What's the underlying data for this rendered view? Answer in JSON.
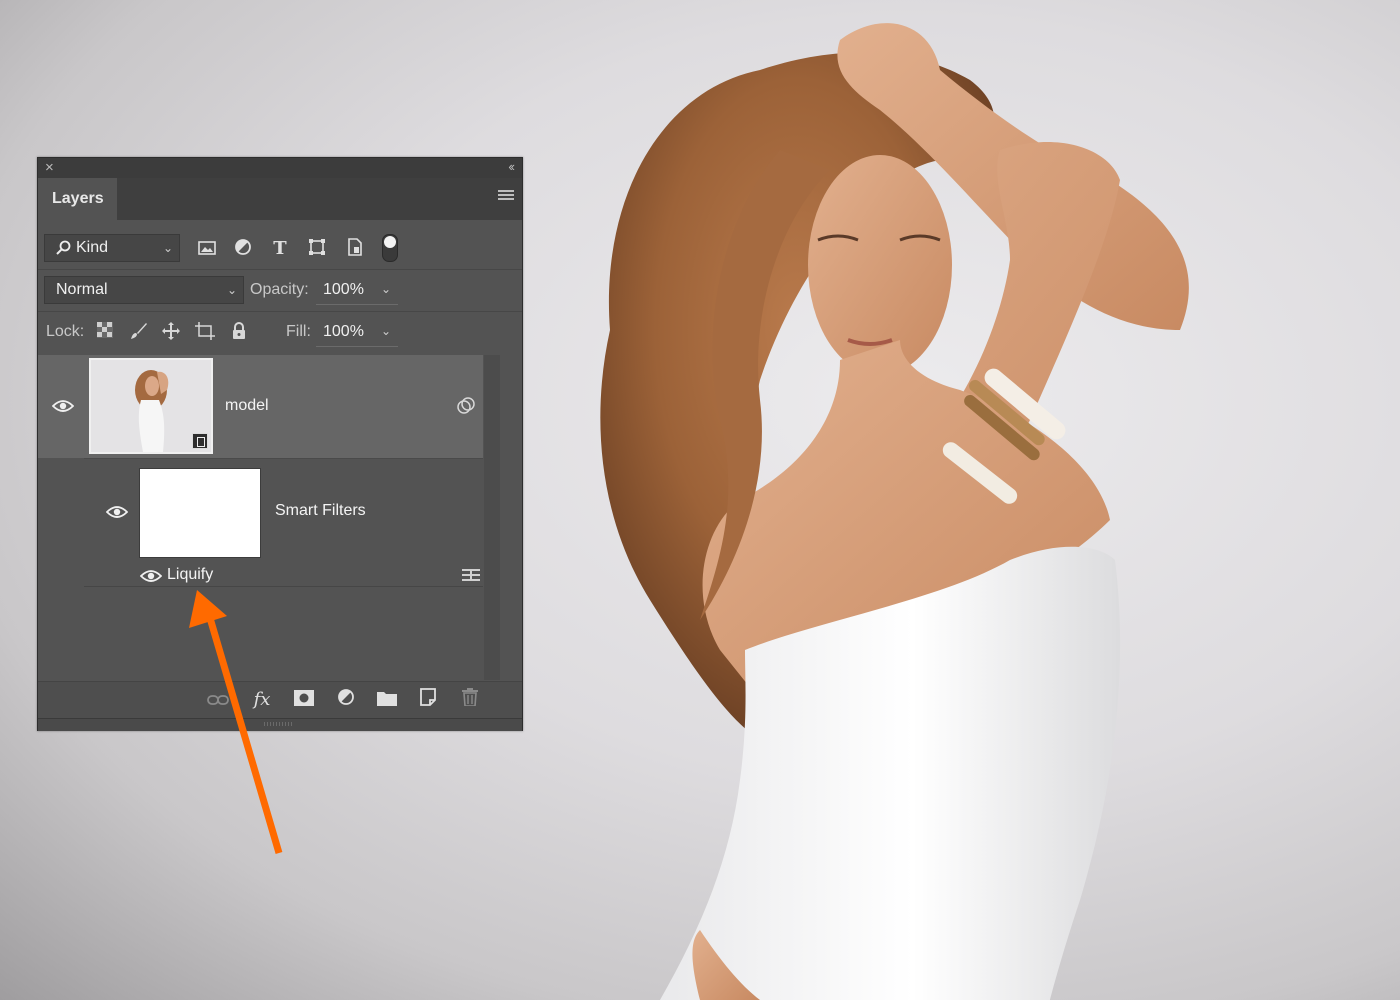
{
  "panel": {
    "tab_label": "Layers",
    "close_glyph": "×",
    "collapse_glyph": "‹‹"
  },
  "filter": {
    "kind_label": "Kind",
    "icons": [
      "image-filter-icon",
      "adjustment-filter-icon",
      "type-filter-icon",
      "shape-filter-icon",
      "smart-object-filter-icon"
    ],
    "toggle_on": true
  },
  "blend": {
    "mode": "Normal",
    "opacity_label": "Opacity:",
    "opacity_value": "100%"
  },
  "lock": {
    "label": "Lock:",
    "icons": [
      "lock-transparent-pixels-icon",
      "lock-image-pixels-icon",
      "lock-position-icon",
      "lock-artboard-icon",
      "lock-all-icon"
    ],
    "fill_label": "Fill:",
    "fill_value": "100%"
  },
  "layers": [
    {
      "name": "model",
      "visible": true,
      "selected": true,
      "type": "smart-object",
      "smart_filters": {
        "name": "Smart Filters",
        "visible": true,
        "filters": [
          {
            "name": "Liquify",
            "visible": true
          }
        ]
      }
    }
  ],
  "bottom_bar": {
    "icons": [
      "link-layers-icon",
      "fx-icon",
      "add-mask-icon",
      "new-adjustment-icon",
      "new-group-icon",
      "new-layer-icon",
      "delete-layer-icon"
    ],
    "fx_label": "fx"
  },
  "annotation": {
    "arrow_color": "#ff6a00"
  }
}
